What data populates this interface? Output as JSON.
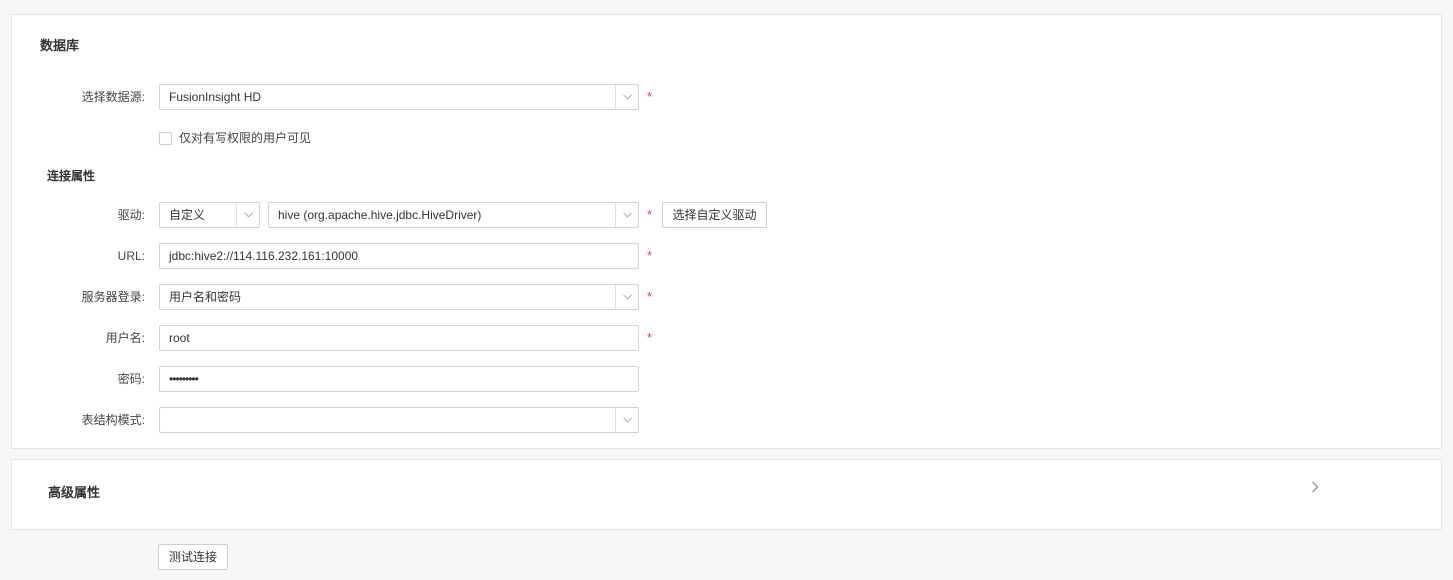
{
  "database_section": {
    "title": "数据库",
    "datasource": {
      "label": "选择数据源:",
      "value": "FusionInsight HD",
      "required": "*"
    },
    "write_only_checkbox": {
      "label": "仅对有写权限的用户可见",
      "checked": false
    },
    "connection_title": "连接属性",
    "driver": {
      "label": "驱动:",
      "type_value": "自定义",
      "driver_value": "hive (org.apache.hive.jdbc.HiveDriver)",
      "required": "*",
      "choose_button": "选择自定义驱动"
    },
    "url": {
      "label": "URL:",
      "value": "jdbc:hive2://114.116.232.161:10000",
      "required": "*"
    },
    "server_login": {
      "label": "服务器登录:",
      "value": "用户名和密码",
      "required": "*"
    },
    "username": {
      "label": "用户名:",
      "value": "root",
      "required": "*"
    },
    "password": {
      "label": "密码:",
      "value": "•••••••••"
    },
    "schema": {
      "label": "表结构模式:",
      "value": ""
    }
  },
  "advanced_section": {
    "title": "高级属性",
    "icon": "chevron-right-icon"
  },
  "test_connection_button": "测试连接",
  "colors": {
    "required": "#e64a3c",
    "border": "#cfd4da",
    "background": "#f6f7f9"
  }
}
